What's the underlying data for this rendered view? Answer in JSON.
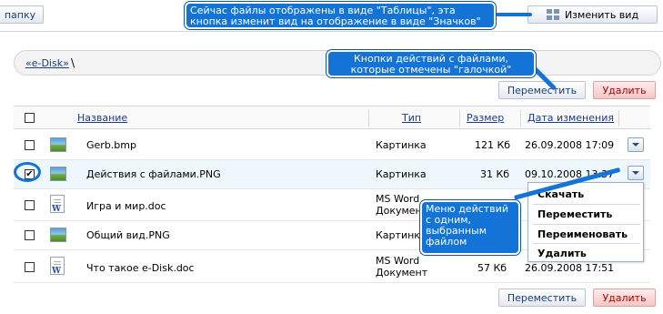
{
  "toolbar": {
    "new_folder_label": "папку",
    "change_view_label": "Изменить вид",
    "change_view_icon": "grid-icon"
  },
  "breadcrumb": {
    "root_label": "«e-Disk»",
    "separator": "\\"
  },
  "actions": {
    "move_label": "Переместить",
    "delete_label": "Удалить"
  },
  "table": {
    "columns": {
      "name": "Название",
      "type": "Тип",
      "size": "Размер",
      "modified": "Дата изменения"
    },
    "rows": [
      {
        "name": "Gerb.bmp",
        "type": "Картинка",
        "type2": "",
        "size": "121 Кб",
        "modified": "26.09.2008 17:09",
        "icon": "image-file-icon",
        "checked": false
      },
      {
        "name": "Действия с файлами.PNG",
        "type": "Картинка",
        "type2": "",
        "size": "31 Кб",
        "modified": "09.10.2008 13:37",
        "icon": "image-file-icon",
        "checked": true
      },
      {
        "name": "Игра и мир.doc",
        "type": "MS Word",
        "type2": "Документ",
        "size": "",
        "modified": "",
        "icon": "word-file-icon",
        "checked": false
      },
      {
        "name": "Общий вид.PNG",
        "type": "Картинка",
        "type2": "",
        "size": "",
        "modified": "",
        "icon": "image-file-icon",
        "checked": false
      },
      {
        "name": "Что такое e-Disk.doc",
        "type": "MS Word",
        "type2": "Документ",
        "size": "57 Кб",
        "modified": "26.09.2008 17:51",
        "icon": "word-file-icon",
        "checked": false
      }
    ]
  },
  "row_menu": {
    "items": [
      "Скачать",
      "Переместить",
      "Переименовать",
      "Удалить"
    ]
  },
  "callouts": {
    "view": "Сейчас файлы отображены в виде \"Таблицы\", эта кнопка изменит вид на отображение в виде \"Значков\"",
    "actions": "Кнопки действий с файлами, которые отмечены \"галочкой\"",
    "menu": "Меню действий с одним, выбранным файлом"
  },
  "colors": {
    "accent": "#1373d6",
    "link": "#1a3a8c",
    "delete": "#b30000"
  }
}
